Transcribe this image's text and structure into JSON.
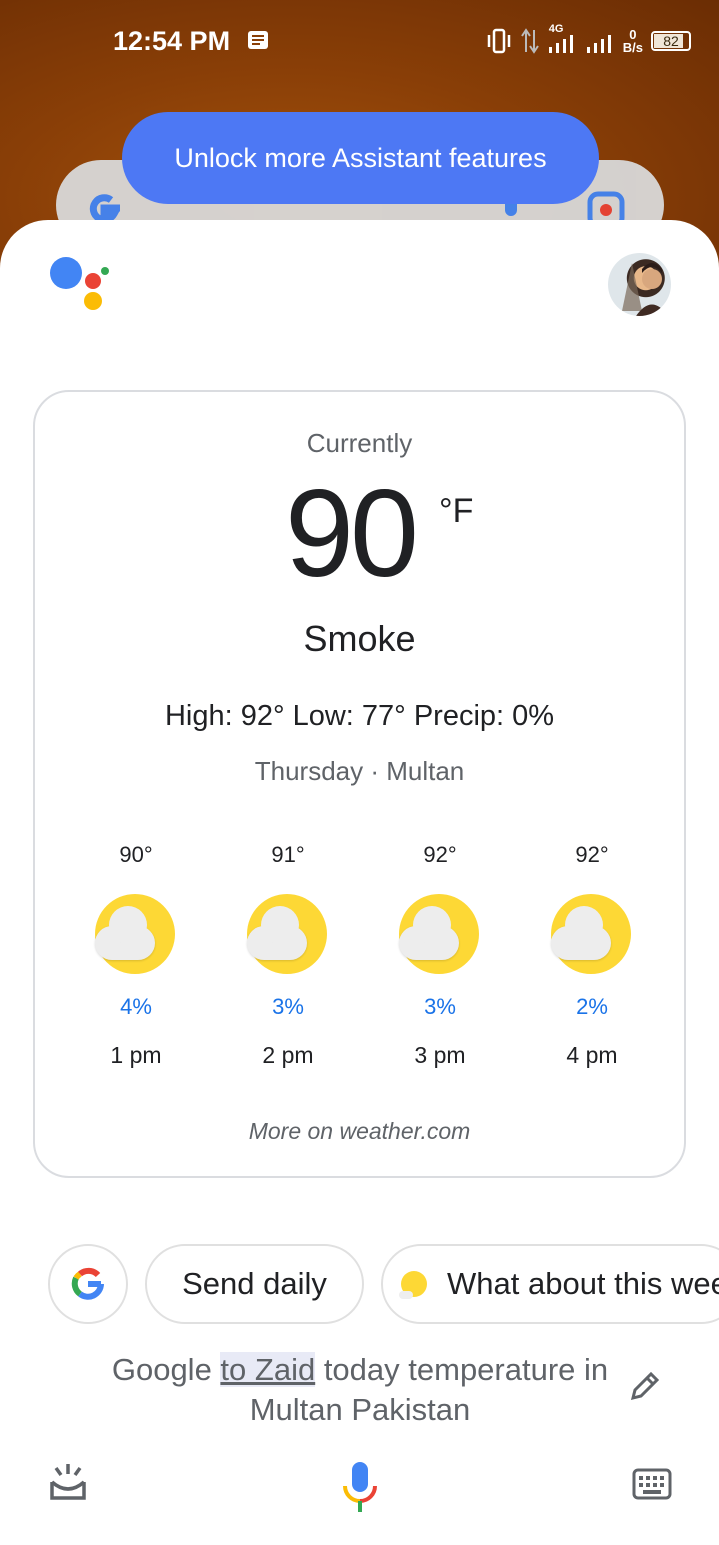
{
  "status_bar": {
    "time": "12:54 PM",
    "network": "4G",
    "data_rate_value": "0",
    "data_rate_unit": "B/s",
    "battery": "82"
  },
  "banner": {
    "unlock_label": "Unlock more Assistant features"
  },
  "weather": {
    "currently_label": "Currently",
    "temperature": "90",
    "unit": "°F",
    "condition": "Smoke",
    "high_low_precip": "High: 92° Low: 77°  Precip: 0%",
    "day_location": "Thursday · Multan",
    "hourly": [
      {
        "temp": "90°",
        "precip": "4%",
        "time": "1 pm",
        "icon": "partly-cloudy-icon"
      },
      {
        "temp": "91°",
        "precip": "3%",
        "time": "2 pm",
        "icon": "partly-cloudy-icon"
      },
      {
        "temp": "92°",
        "precip": "3%",
        "time": "3 pm",
        "icon": "partly-cloudy-icon"
      },
      {
        "temp": "92°",
        "precip": "2%",
        "time": "4 pm",
        "icon": "partly-cloudy-icon"
      }
    ],
    "more_link": "More on weather.com"
  },
  "suggestions": {
    "chip_send": "Send daily",
    "chip_what": "What about this weekend"
  },
  "query": {
    "part1": "Google ",
    "highlight": "to Zaid",
    "part2": " today temperature in Multan Pakistan"
  },
  "colors": {
    "accent_blue": "#4d78f4",
    "precip_blue": "#1a73e8",
    "sun_yellow": "#fdd835"
  }
}
